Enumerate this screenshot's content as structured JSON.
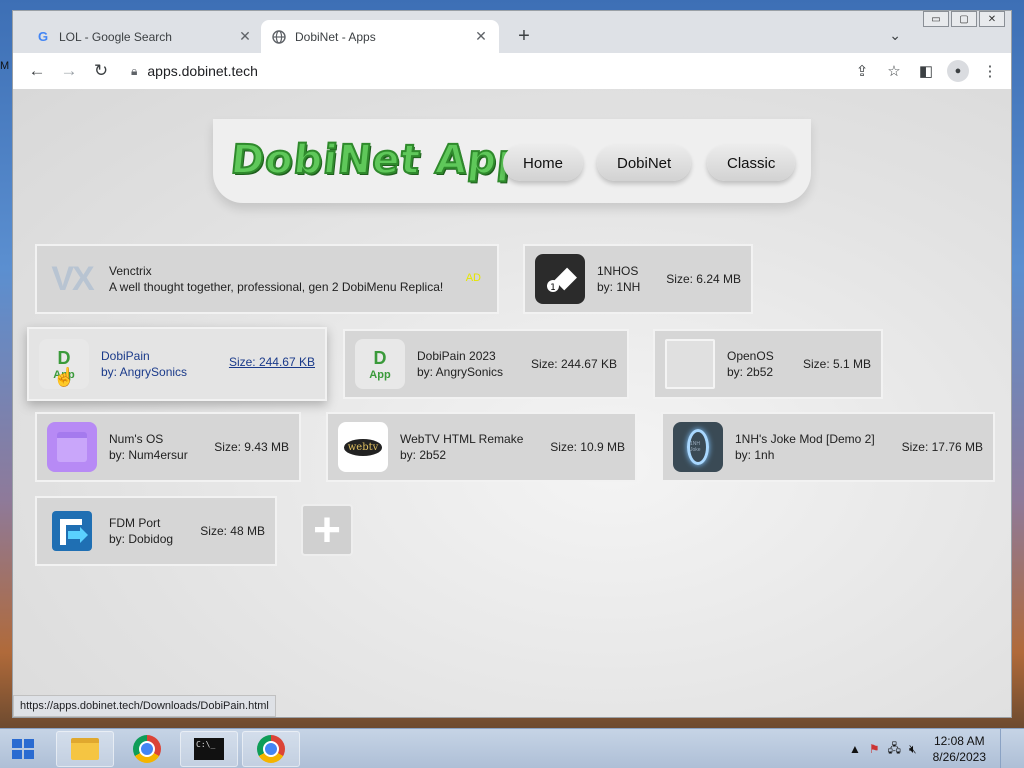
{
  "desktop": {
    "edge_text": "M"
  },
  "browser": {
    "tabs": [
      {
        "favicon": "G",
        "title": "LOL - Google Search",
        "active": false
      },
      {
        "favicon": "globe-icon",
        "title": "DobiNet - Apps",
        "active": true
      }
    ],
    "url": "apps.dobinet.tech",
    "status_url": "https://apps.dobinet.tech/Downloads/DobiPain.html"
  },
  "page": {
    "logo_text": "DobiNet Apps",
    "nav": [
      "Home",
      "DobiNet",
      "Classic"
    ],
    "ad_card": {
      "logo": "VX",
      "name": "Venctrix",
      "desc": "A well thought together, professional, gen 2 DobiMenu Replica!",
      "badge": "AD"
    },
    "apps": [
      {
        "name": "1NHOS",
        "author": "by: 1NH",
        "size": "Size: 6.24 MB"
      },
      {
        "name": "DobiPain",
        "author": "by: AngrySonics",
        "size": "Size: 244.67 KB"
      },
      {
        "name": "DobiPain 2023",
        "author": "by: AngrySonics",
        "size": "Size: 244.67 KB"
      },
      {
        "name": "OpenOS",
        "author": "by: 2b52",
        "size": "Size: 5.1 MB"
      },
      {
        "name": "Num's OS",
        "author": "by: Num4ersur",
        "size": "Size: 9.43 MB"
      },
      {
        "name": "WebTV HTML Remake",
        "author": "by: 2b52",
        "size": "Size: 10.9 MB"
      },
      {
        "name": "1NH's Joke Mod [Demo 2]",
        "author": "by: 1nh",
        "size": "Size: 17.76 MB"
      },
      {
        "name": "FDM Port",
        "author": "by: Dobidog",
        "size": "Size: 48 MB"
      }
    ],
    "icon_text": {
      "dobipain": "App",
      "webtv": "webtv",
      "nhjoke": "1NH Joke"
    }
  },
  "taskbar": {
    "time": "12:08 AM",
    "date": "8/26/2023"
  }
}
